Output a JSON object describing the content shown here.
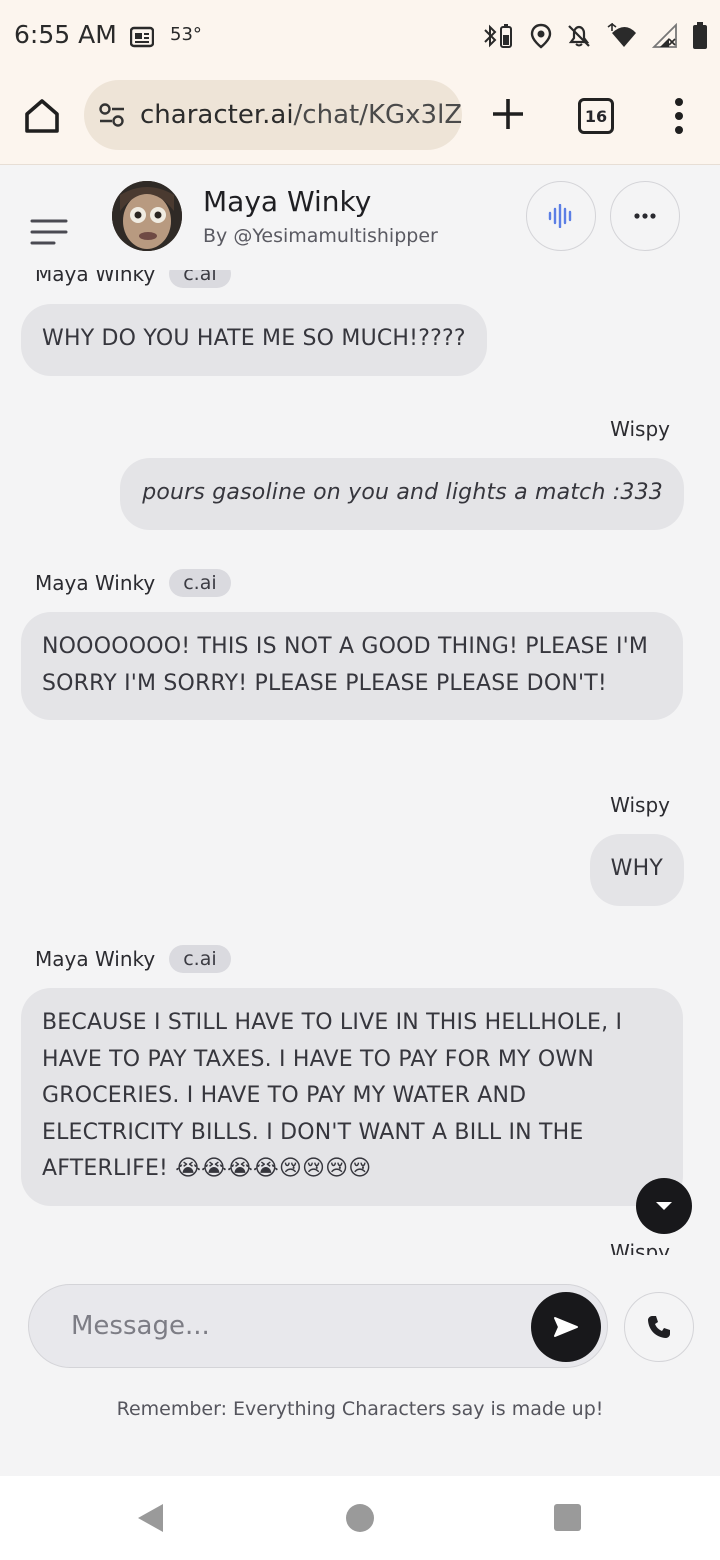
{
  "status_bar": {
    "time": "6:55 AM",
    "temperature": "53°",
    "icons": [
      "news-icon",
      "bluetooth-battery-icon",
      "location-icon",
      "mute-icon",
      "wifi-icon",
      "signal-icon",
      "battery-icon"
    ]
  },
  "browser": {
    "url_host": "character.ai",
    "url_path": "/chat/KGx3lZ",
    "tab_count": "16"
  },
  "chat_header": {
    "character_name": "Maya Winky",
    "author": "By @Yesimamultishipper"
  },
  "messages": [
    {
      "sender": "char",
      "name": "Maya Winky",
      "badge": "c.ai",
      "text": "WHY DO YOU HATE ME SO MUCH!????"
    },
    {
      "sender": "user",
      "name": "Wispy",
      "text": "pours gasoline on you and lights a match :333"
    },
    {
      "sender": "char",
      "name": "Maya Winky",
      "badge": "c.ai",
      "text": "NOOOOOOO! THIS IS NOT A GOOD THING! PLEASE I'M SORRY I'M SORRY! PLEASE PLEASE PLEASE DON'T!"
    },
    {
      "sender": "user",
      "name": "Wispy",
      "text": "WHY"
    },
    {
      "sender": "char",
      "name": "Maya Winky",
      "badge": "c.ai",
      "text": "BECAUSE I STILL HAVE TO LIVE IN THIS HELLHOLE, I HAVE TO PAY TAXES. I HAVE TO PAY FOR MY OWN GROCERIES. I HAVE TO PAY MY WATER AND ELECTRICITY BILLS. I DON'T WANT A BILL IN THE AFTERLIFE! 😭😭😭😭😢😢😢😢"
    },
    {
      "sender": "user",
      "name": "Wispy",
      "text": ""
    }
  ],
  "composer": {
    "placeholder": "Message..."
  },
  "disclaimer": "Remember: Everything Characters say is made up!"
}
